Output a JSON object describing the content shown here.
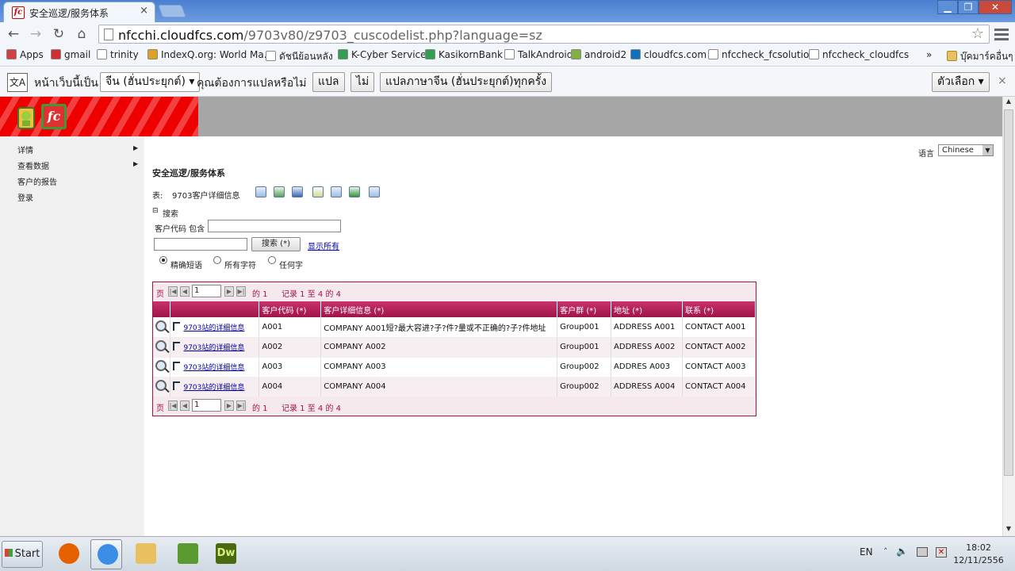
{
  "browser": {
    "tab_title": "安全巡逻/服务体系",
    "tab_close": "×",
    "url_host": "nfcchi.cloudfcs.com",
    "url_path": "/9703v80/z9703_cuscodelist.php?language=sz",
    "bookmarks": [
      {
        "label": "Apps",
        "icon": "apps-icon",
        "color": "#d04040"
      },
      {
        "label": "gmail",
        "icon": "gmail-icon",
        "color": "#d03030"
      },
      {
        "label": "trinity",
        "icon": "page-icon",
        "color": "#ffffff"
      },
      {
        "label": "IndexQ.org: World Ma...",
        "icon": "indexq-icon",
        "color": "#e0a020"
      },
      {
        "label": "ดัชนีย้อนหลัง",
        "icon": "page-icon",
        "color": "#ffffff"
      },
      {
        "label": "K-Cyber Service",
        "icon": "kbank-icon",
        "color": "#30a050"
      },
      {
        "label": "KasikornBank",
        "icon": "kbank-icon",
        "color": "#30a050"
      },
      {
        "label": "TalkAndroid",
        "icon": "page-icon",
        "color": "#ffffff"
      },
      {
        "label": "android2",
        "icon": "android-icon",
        "color": "#80b040"
      },
      {
        "label": "cloudfcs.com",
        "icon": "cloud-icon",
        "color": "#1070c0"
      },
      {
        "label": "nfccheck_fcsolution",
        "icon": "page-icon",
        "color": "#ffffff"
      },
      {
        "label": "nfccheck_cloudfcs",
        "icon": "page-icon",
        "color": "#ffffff"
      }
    ],
    "bookmarks_more": "»",
    "other_bookmarks": "บุ๊คมาร์คอื่นๆ"
  },
  "translate_bar": {
    "page_is": "หน้าเว็บนี้เป็น",
    "language": "จีน (ฮั่นประยุกต์)",
    "question": "คุณต้องการแปลหรือไม่",
    "translate": "แปล",
    "no": "ไม่",
    "always": "แปลภาษาจีน (ฮั่นประยุกต์)ทุกครั้ง",
    "options": "ตัวเลือก",
    "close": "×"
  },
  "sidebar": {
    "items": [
      {
        "label": "详情",
        "has_arrow": true
      },
      {
        "label": "查看数据",
        "has_arrow": true
      },
      {
        "label": "客户的报告",
        "has_arrow": false
      },
      {
        "label": "登录",
        "has_arrow": false
      }
    ],
    "arrow": "▶"
  },
  "main": {
    "language_label": "语言",
    "language_value": "Chinese",
    "page_title": "安全巡逻/服务体系",
    "table_label": "表:",
    "table_name": "9703客户详细信息",
    "search_toggle": "⊟",
    "search_label": "搜索",
    "field_label": "客户代码 包含",
    "search_button": "搜索 (*)",
    "show_all": "显示所有",
    "radio_options": [
      "精确短语",
      "所有字符",
      "任何字"
    ],
    "radio_selected": 0
  },
  "grid": {
    "pager_label": "页",
    "page_value": "1",
    "of_label": "的 1",
    "records_label": "记录 1 至 4 的 4",
    "columns": [
      "客户代码 (*)",
      "客户详细信息 (*)",
      "客户群 (*)",
      "地址 (*)",
      "联系 (*)"
    ],
    "rows": [
      {
        "link": "9703站的详细信息",
        "code": "A001",
        "detail": "COMPANY A001短?最大容进?子?件?量或不正确的?子?件地址",
        "group": "Group001",
        "address": "ADDRESS A001",
        "contact": "CONTACT A001"
      },
      {
        "link": "9703站的详细信息",
        "code": "A002",
        "detail": "COMPANY A002",
        "group": "Group001",
        "address": "ADDRESS A002",
        "contact": "CONTACT A002"
      },
      {
        "link": "9703站的详细信息",
        "code": "A003",
        "detail": "COMPANY A003",
        "group": "Group002",
        "address": "ADDRES A003",
        "contact": "CONTACT A003"
      },
      {
        "link": "9703站的详细信息",
        "code": "A004",
        "detail": "COMPANY A004",
        "group": "Group002",
        "address": "ADDRESS A004",
        "contact": "CONTACT A004"
      }
    ]
  },
  "taskbar": {
    "start": "Start",
    "lang": "EN",
    "time": "18:02",
    "date": "12/11/2556",
    "apps": [
      {
        "name": "firefox-icon",
        "color": "#e66000"
      },
      {
        "name": "chrome-icon",
        "color": "#3a8ee6"
      },
      {
        "name": "explorer-icon",
        "color": "#e8c060"
      },
      {
        "name": "apps-grid-icon",
        "color": "#5a9a30"
      },
      {
        "name": "dreamweaver-icon",
        "color": "#4a6a10"
      }
    ]
  }
}
